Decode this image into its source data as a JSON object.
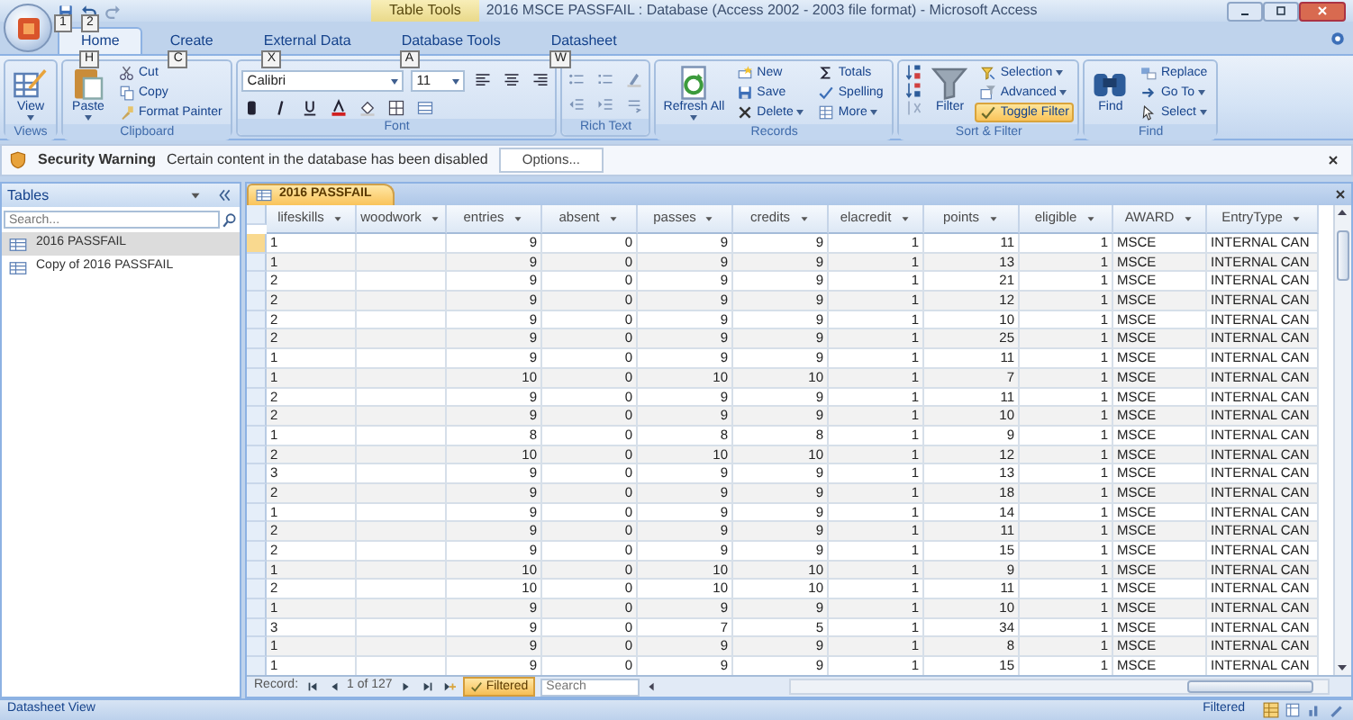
{
  "window": {
    "title": "2016 MSCE PASSFAIL : Database (Access 2002 - 2003 file format) - Microsoft Access",
    "context_tab": "Table Tools"
  },
  "quick_access_keytips": [
    "1",
    "2"
  ],
  "tabs": [
    {
      "label": "Home",
      "keytip": "H",
      "selected": true
    },
    {
      "label": "Create",
      "keytip": "C",
      "selected": false
    },
    {
      "label": "External Data",
      "keytip": "X",
      "selected": false
    },
    {
      "label": "Database Tools",
      "keytip": "A",
      "selected": false
    },
    {
      "label": "Datasheet",
      "keytip": "W",
      "selected": false
    }
  ],
  "ribbon": [
    {
      "kind": "buttons",
      "label": "Views",
      "items": [
        {
          "label": "View",
          "kind": "large",
          "dropdown": true
        }
      ]
    },
    {
      "kind": "buttons",
      "label": "Clipboard",
      "items": [
        {
          "label": "Paste",
          "kind": "large",
          "dropdown": true
        },
        {
          "label": "Cut",
          "kind": "small",
          "dropdown": false
        },
        {
          "label": "Copy",
          "kind": "small",
          "dropdown": false
        },
        {
          "label": "Format Painter",
          "kind": "small",
          "dropdown": false
        }
      ]
    },
    {
      "kind": "font",
      "label": "Font",
      "font_name": "Calibri",
      "font_size": "11"
    },
    {
      "kind": "icons",
      "label": "Rich Text"
    },
    {
      "kind": "buttons",
      "label": "Records",
      "items": [
        {
          "label": "Refresh All",
          "kind": "large",
          "dropdown": true
        },
        {
          "label": "New",
          "kind": "small",
          "dropdown": false
        },
        {
          "label": "Save",
          "kind": "small",
          "dropdown": false
        },
        {
          "label": "Delete",
          "kind": "small",
          "dropdown": true
        },
        {
          "label": "Totals",
          "kind": "small",
          "dropdown": false
        },
        {
          "label": "Spelling",
          "kind": "small",
          "dropdown": false
        },
        {
          "label": "More",
          "kind": "small",
          "dropdown": true
        }
      ]
    },
    {
      "kind": "sort",
      "label": "Sort & Filter",
      "items": [
        {
          "label": "Filter",
          "kind": "large",
          "dropdown": false
        },
        {
          "label": "Selection",
          "kind": "small",
          "dropdown": true
        },
        {
          "label": "Advanced",
          "kind": "small",
          "dropdown": true
        },
        {
          "label": "Toggle Filter",
          "kind": "small",
          "dropdown": false,
          "on": true
        }
      ]
    },
    {
      "kind": "buttons",
      "label": "Find",
      "items": [
        {
          "label": "Find",
          "kind": "large",
          "dropdown": false
        },
        {
          "label": "Replace",
          "kind": "small",
          "dropdown": false
        },
        {
          "label": "Go To",
          "kind": "small",
          "dropdown": true
        },
        {
          "label": "Select",
          "kind": "small",
          "dropdown": true
        }
      ]
    }
  ],
  "security_bar": {
    "title": "Security Warning",
    "message": "Certain content in the database has been disabled",
    "button": "Options..."
  },
  "navigation_pane": {
    "title": "Tables",
    "search": {
      "placeholder": "Search..."
    },
    "items": [
      {
        "label": "2016 PASSFAIL",
        "selected": true
      },
      {
        "label": "Copy of 2016 PASSFAIL",
        "selected": false
      }
    ]
  },
  "document_tab": {
    "label": "2016 PASSFAIL"
  },
  "table": {
    "columns": [
      {
        "label": "lifeskills",
        "kind": "text"
      },
      {
        "label": "woodwork",
        "kind": "text"
      },
      {
        "label": "entries",
        "kind": "number"
      },
      {
        "label": "absent",
        "kind": "number"
      },
      {
        "label": "passes",
        "kind": "number"
      },
      {
        "label": "credits",
        "kind": "number"
      },
      {
        "label": "elacredit",
        "kind": "number"
      },
      {
        "label": "points",
        "kind": "number"
      },
      {
        "label": "eligible",
        "kind": "number"
      },
      {
        "label": "AWARD",
        "kind": "text"
      },
      {
        "label": "EntryType",
        "kind": "text"
      }
    ],
    "rows": [
      {
        "current": true,
        "cells": [
          "1",
          null,
          "9",
          "0",
          "9",
          "9",
          "1",
          "11",
          "1",
          "MSCE",
          "INTERNAL CAN"
        ]
      },
      {
        "current": false,
        "cells": [
          "1",
          null,
          "9",
          "0",
          "9",
          "9",
          "1",
          "13",
          "1",
          "MSCE",
          "INTERNAL CAN"
        ]
      },
      {
        "current": false,
        "cells": [
          "2",
          null,
          "9",
          "0",
          "9",
          "9",
          "1",
          "21",
          "1",
          "MSCE",
          "INTERNAL CAN"
        ]
      },
      {
        "current": false,
        "cells": [
          "2",
          null,
          "9",
          "0",
          "9",
          "9",
          "1",
          "12",
          "1",
          "MSCE",
          "INTERNAL CAN"
        ]
      },
      {
        "current": false,
        "cells": [
          "2",
          null,
          "9",
          "0",
          "9",
          "9",
          "1",
          "10",
          "1",
          "MSCE",
          "INTERNAL CAN"
        ]
      },
      {
        "current": false,
        "cells": [
          "2",
          null,
          "9",
          "0",
          "9",
          "9",
          "1",
          "25",
          "1",
          "MSCE",
          "INTERNAL CAN"
        ]
      },
      {
        "current": false,
        "cells": [
          "1",
          null,
          "9",
          "0",
          "9",
          "9",
          "1",
          "11",
          "1",
          "MSCE",
          "INTERNAL CAN"
        ]
      },
      {
        "current": false,
        "cells": [
          "1",
          null,
          "10",
          "0",
          "10",
          "10",
          "1",
          "7",
          "1",
          "MSCE",
          "INTERNAL CAN"
        ]
      },
      {
        "current": false,
        "cells": [
          "2",
          null,
          "9",
          "0",
          "9",
          "9",
          "1",
          "11",
          "1",
          "MSCE",
          "INTERNAL CAN"
        ]
      },
      {
        "current": false,
        "cells": [
          "2",
          null,
          "9",
          "0",
          "9",
          "9",
          "1",
          "10",
          "1",
          "MSCE",
          "INTERNAL CAN"
        ]
      },
      {
        "current": false,
        "cells": [
          "1",
          null,
          "8",
          "0",
          "8",
          "8",
          "1",
          "9",
          "1",
          "MSCE",
          "INTERNAL CAN"
        ]
      },
      {
        "current": false,
        "cells": [
          "2",
          null,
          "10",
          "0",
          "10",
          "10",
          "1",
          "12",
          "1",
          "MSCE",
          "INTERNAL CAN"
        ]
      },
      {
        "current": false,
        "cells": [
          "3",
          null,
          "9",
          "0",
          "9",
          "9",
          "1",
          "13",
          "1",
          "MSCE",
          "INTERNAL CAN"
        ]
      },
      {
        "current": false,
        "cells": [
          "2",
          null,
          "9",
          "0",
          "9",
          "9",
          "1",
          "18",
          "1",
          "MSCE",
          "INTERNAL CAN"
        ]
      },
      {
        "current": false,
        "cells": [
          "1",
          null,
          "9",
          "0",
          "9",
          "9",
          "1",
          "14",
          "1",
          "MSCE",
          "INTERNAL CAN"
        ]
      },
      {
        "current": false,
        "cells": [
          "2",
          null,
          "9",
          "0",
          "9",
          "9",
          "1",
          "11",
          "1",
          "MSCE",
          "INTERNAL CAN"
        ]
      },
      {
        "current": false,
        "cells": [
          "2",
          null,
          "9",
          "0",
          "9",
          "9",
          "1",
          "15",
          "1",
          "MSCE",
          "INTERNAL CAN"
        ]
      },
      {
        "current": false,
        "cells": [
          "1",
          null,
          "10",
          "0",
          "10",
          "10",
          "1",
          "9",
          "1",
          "MSCE",
          "INTERNAL CAN"
        ]
      },
      {
        "current": false,
        "cells": [
          "2",
          null,
          "10",
          "0",
          "10",
          "10",
          "1",
          "11",
          "1",
          "MSCE",
          "INTERNAL CAN"
        ]
      },
      {
        "current": false,
        "cells": [
          "1",
          null,
          "9",
          "0",
          "9",
          "9",
          "1",
          "10",
          "1",
          "MSCE",
          "INTERNAL CAN"
        ]
      },
      {
        "current": false,
        "cells": [
          "3",
          null,
          "9",
          "0",
          "7",
          "5",
          "1",
          "34",
          "1",
          "MSCE",
          "INTERNAL CAN"
        ]
      },
      {
        "current": false,
        "cells": [
          "1",
          null,
          "9",
          "0",
          "9",
          "9",
          "1",
          "8",
          "1",
          "MSCE",
          "INTERNAL CAN"
        ]
      },
      {
        "current": false,
        "cells": [
          "1",
          null,
          "9",
          "0",
          "9",
          "9",
          "1",
          "15",
          "1",
          "MSCE",
          "INTERNAL CAN"
        ]
      }
    ]
  },
  "record_nav": {
    "label": "Record:",
    "position": "1 of 127",
    "filter": "Filtered",
    "filter_on": true,
    "search": {
      "placeholder": "Search"
    }
  },
  "status_bar": {
    "left": "Datasheet View",
    "right": "Filtered"
  }
}
